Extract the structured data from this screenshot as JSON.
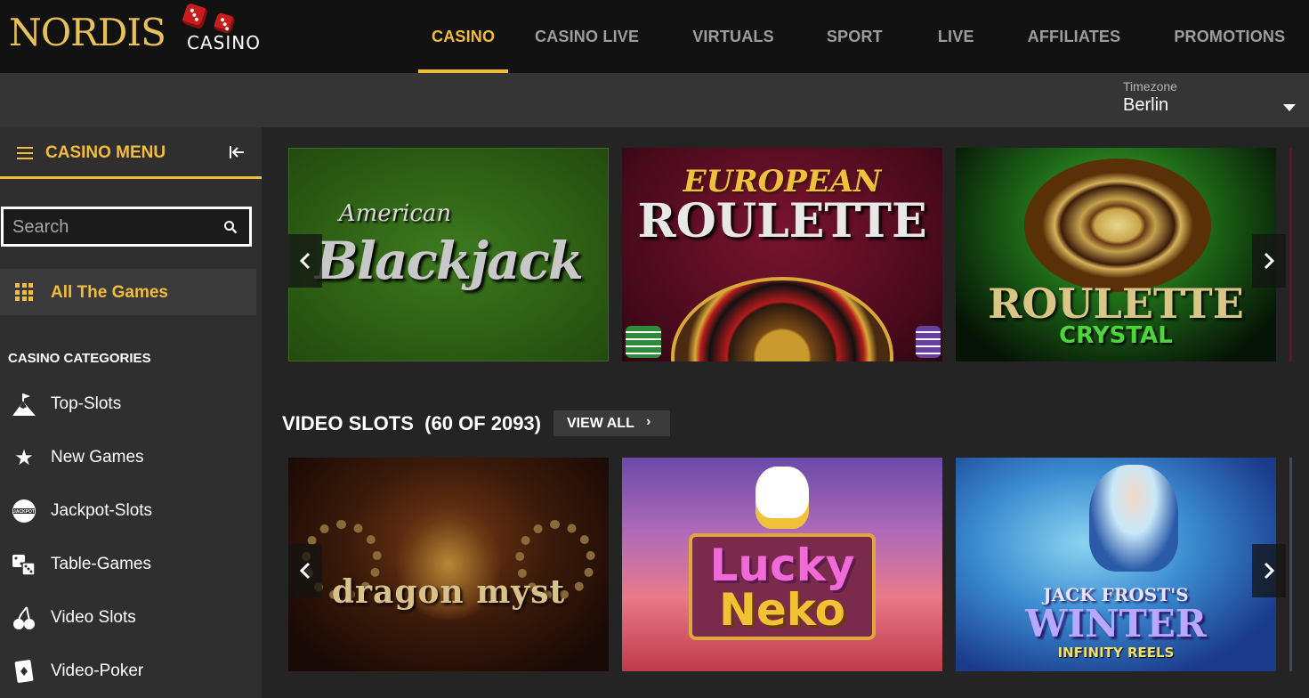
{
  "brand": {
    "name": "NORDIS",
    "sub": "CASINO"
  },
  "nav": [
    {
      "label": "CASINO",
      "active": true
    },
    {
      "label": "CASINO LIVE",
      "active": false
    },
    {
      "label": "VIRTUALS",
      "active": false
    },
    {
      "label": "SPORT",
      "active": false
    },
    {
      "label": "LIVE",
      "active": false
    },
    {
      "label": "AFFILIATES",
      "active": false
    },
    {
      "label": "PROMOTIONS",
      "active": false
    }
  ],
  "timezone": {
    "label": "Timezone",
    "value": "Berlin"
  },
  "sidebar": {
    "menu_title": "CASINO MENU",
    "search_placeholder": "Search",
    "all_games": "All The Games",
    "categories_title": "CASINO CATEGORIES",
    "categories": [
      {
        "label": "Top-Slots",
        "icon": "mountain-flag-icon"
      },
      {
        "label": "New Games",
        "icon": "star-icon"
      },
      {
        "label": "Jackpot-Slots",
        "icon": "jackpot-icon"
      },
      {
        "label": "Table-Games",
        "icon": "dice-icon"
      },
      {
        "label": "Video Slots",
        "icon": "cherry-icon"
      },
      {
        "label": "Video-Poker",
        "icon": "card-icon"
      }
    ]
  },
  "table_games": [
    {
      "title_top": "American",
      "title_main": "Blackjack"
    },
    {
      "title_top": "EUROPEAN",
      "title_main": "ROULETTE"
    },
    {
      "title_top": "ROULETTE",
      "title_main": "CRYSTAL"
    }
  ],
  "video_slots": {
    "title": "VIDEO SLOTS",
    "count": "(60 OF 2093)",
    "view_all": "VIEW ALL",
    "games": [
      {
        "title_main": "dragon myst"
      },
      {
        "title_main": "Lucky",
        "title_sub": "Neko"
      },
      {
        "title_top": "JACK FROST'S",
        "title_main": "WINTER",
        "title_sub": "INFINITY REELS"
      }
    ]
  },
  "colors": {
    "accent": "#f3bd3c",
    "header_bg": "#121212",
    "sidebar_bg": "#2f2f2f",
    "main_bg": "#242424"
  }
}
